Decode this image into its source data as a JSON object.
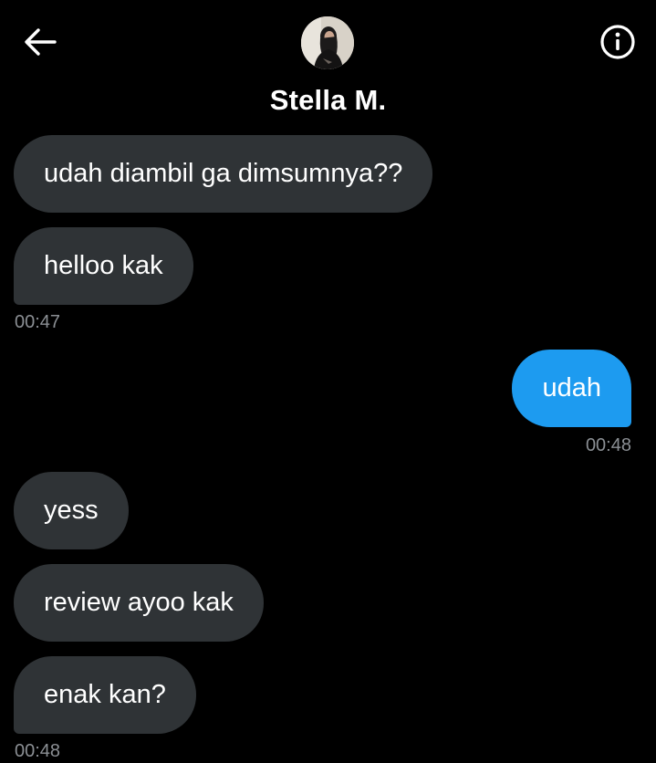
{
  "header": {
    "contact_name": "Stella M.",
    "back_icon": "arrow-left-icon",
    "info_icon": "info-circle-icon",
    "avatar": "contact-avatar-photo"
  },
  "colors": {
    "background": "#000000",
    "incoming_bubble": "#2f3336",
    "outgoing_bubble": "#1d9bf0",
    "timestamp_text": "#8b8f94",
    "text": "#ffffff"
  },
  "messages": [
    {
      "direction": "incoming",
      "text": "udah diambil ga dimsumnya??"
    },
    {
      "direction": "incoming",
      "text": "helloo kak",
      "time": "00:47"
    },
    {
      "direction": "outgoing",
      "text": "udah",
      "time": "00:48"
    },
    {
      "direction": "incoming",
      "text": "yess"
    },
    {
      "direction": "incoming",
      "text": "review ayoo kak"
    },
    {
      "direction": "incoming",
      "text": "enak kan?",
      "time": "00:48"
    }
  ]
}
